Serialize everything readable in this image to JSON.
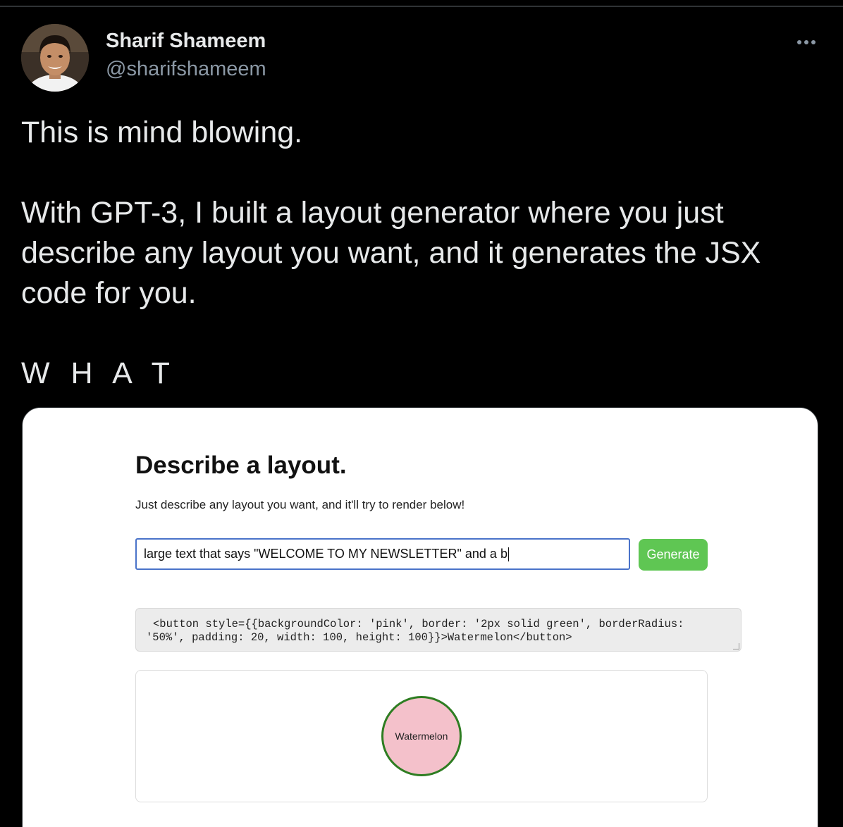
{
  "tweet": {
    "author": {
      "display_name": "Sharif Shameem",
      "handle": "@sharifshameem"
    },
    "text_lines": {
      "line1": "This is mind blowing.",
      "line2": "With GPT-3, I built a layout generator where you just",
      "line3": "describe any layout you want, and it generates the JSX",
      "line4": "code for you.",
      "line5": "W H A T"
    },
    "more_icon": "more-horizontal-icon"
  },
  "media": {
    "heading": "Describe a layout.",
    "subheading": "Just describe any layout you want, and it'll try to render below!",
    "input_value": "large text that says \"WELCOME TO MY NEWSLETTER\" and a b",
    "generate_label": "Generate",
    "code_line1": "<button style={{backgroundColor: 'pink', border: '2px solid green', borderRadius:",
    "code_line2": "'50%', padding: 20, width: 100, height: 100}}>Watermelon</button>",
    "preview_button_label": "Watermelon",
    "colors": {
      "generate_button": "#5fc653",
      "preview_button_fill": "#f4c1cb",
      "preview_button_border": "#2e7d22",
      "input_border": "#4a73c9"
    }
  }
}
